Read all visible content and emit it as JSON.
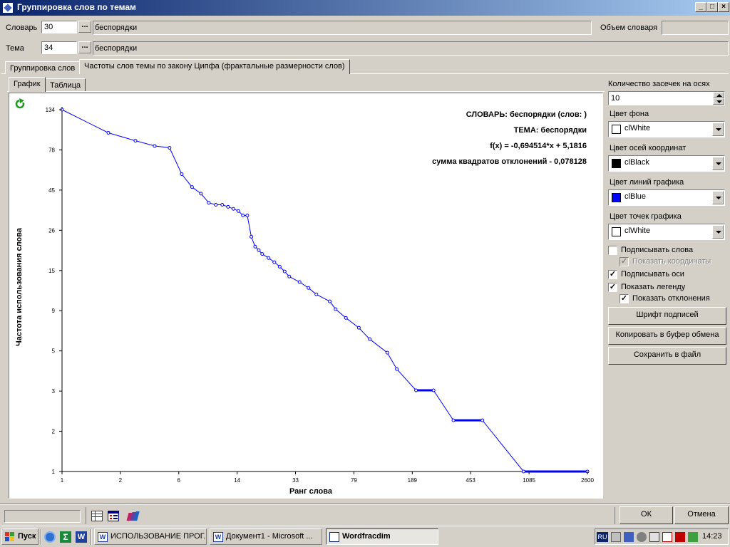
{
  "window": {
    "title": "Группировка слов по темам",
    "minimize": "_",
    "maximize": "□",
    "close": "×"
  },
  "dictionary": {
    "label": "Словарь",
    "number": "30",
    "name": "беспорядки",
    "size_label": "Объем словаря",
    "size_value": ""
  },
  "topic": {
    "label": "Тема",
    "number": "34",
    "name": "беспорядки"
  },
  "main_tabs": [
    "Группировка слов",
    "Частоты слов темы по закону Ципфа (фрактальные размерности слов)"
  ],
  "sub_tabs": [
    "График",
    "Таблица"
  ],
  "settings": {
    "ticks_label": "Количество засечек на осях",
    "ticks_value": "10",
    "bg_color_label": "Цвет фона",
    "bg_color_value": "clWhite",
    "bg_color_hex": "#ffffff",
    "axes_color_label": "Цвет осей координат",
    "axes_color_value": "clBlack",
    "axes_color_hex": "#000000",
    "line_color_label": "Цвет линий графика",
    "line_color_value": "clBlue",
    "line_color_hex": "#0000ff",
    "points_color_label": "Цвет точек графика",
    "points_color_value": "clWhite",
    "points_color_hex": "#ffffff",
    "checkboxes": [
      {
        "label": "Подписывать слова",
        "checked": false,
        "enabled": true
      },
      {
        "label": "Показать координаты",
        "checked": true,
        "enabled": false
      },
      {
        "label": "Подписывать оси",
        "checked": true,
        "enabled": true
      },
      {
        "label": "Показать легенду",
        "checked": true,
        "enabled": true
      },
      {
        "label": "Показать отклонения",
        "checked": true,
        "enabled": true
      }
    ],
    "font_button": "Шрифт подписей",
    "copy_button": "Копировать в буфер обмена",
    "save_button": "Сохранить в файл"
  },
  "bottom": {
    "ok": "ОК",
    "cancel": "Отмена"
  },
  "chart_data": {
    "type": "line",
    "xlabel": "Ранг слова",
    "ylabel": "Частота использования слова",
    "x_scale": "log",
    "y_scale": "log",
    "x_ticks": [
      "1",
      "2",
      "6",
      "14",
      "33",
      "79",
      "189",
      "453",
      "1085",
      "2600"
    ],
    "y_ticks": [
      "1",
      "2",
      "3",
      "5",
      "9",
      "15",
      "26",
      "45",
      "78",
      "134"
    ],
    "xlim": [
      1,
      2600
    ],
    "ylim": [
      1,
      134
    ],
    "legend": [
      "СЛОВАРЬ: беспорядки (слов: )",
      "ТЕМА: беспорядки",
      "f(x) = -0,694514*x + 5,1816",
      "сумма квадратов отклонений - 0,078128"
    ],
    "legend_placement": "top-right",
    "line_color": "#0000ff",
    "point_color": "#ffffff",
    "series": [
      {
        "x": [
          1,
          2,
          3,
          4,
          5,
          6,
          7,
          8,
          9,
          10,
          11,
          12,
          13,
          14,
          15,
          16,
          17,
          18,
          19,
          20,
          22,
          24,
          26,
          28,
          30,
          35,
          40,
          45,
          55,
          60,
          70,
          85,
          100,
          130,
          150,
          200,
          260,
          350,
          540,
          1000,
          2600
        ],
        "y": [
          134,
          98,
          88,
          82,
          80,
          56,
          47,
          43,
          38,
          37,
          37,
          36,
          35,
          34,
          32,
          32,
          24,
          21,
          20,
          19,
          18,
          17,
          16,
          15,
          14,
          13,
          12,
          11,
          10,
          9,
          8,
          7,
          6,
          5,
          4,
          3,
          3,
          2,
          2,
          1,
          1
        ]
      }
    ]
  },
  "taskbar": {
    "start": "Пуск",
    "items": [
      "ИСПОЛЬЗОВАНИЕ ПРОГ...",
      "Документ1 - Microsoft ...",
      "Wordfracdim"
    ],
    "lang": "RU",
    "time": "14:23"
  }
}
